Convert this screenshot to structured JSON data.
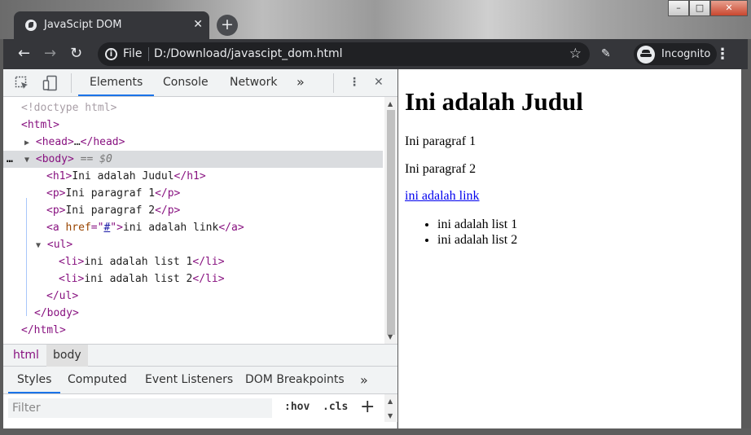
{
  "browser": {
    "tab_title": "JavaScipt DOM",
    "tab_close": "✕",
    "new_tab": "+",
    "window_controls": {
      "minimize": "–",
      "maximize": "□",
      "close": "✕"
    },
    "nav": {
      "back": "←",
      "forward": "→",
      "reload": "↻"
    },
    "omnibox": {
      "scheme": "File",
      "url": "D:/Download/javascipt_dom.html",
      "info_icon": "i"
    },
    "incognito_label": "Incognito",
    "menu": "⋮"
  },
  "devtools": {
    "tabs": [
      "Elements",
      "Console",
      "Network"
    ],
    "more_tabs": "»",
    "menu": "⋮",
    "close": "✕",
    "dom_lines": {
      "doctype": "<!doctype html>",
      "html_open": "html",
      "head": "head",
      "head_ellipsis": "…",
      "body": "body",
      "body_eq": "== $0",
      "selected_dots": "…",
      "h1": "h1",
      "h1_text": "Ini adalah Judul",
      "p": "p",
      "p1_text": "Ini paragraf 1",
      "p2_text": "Ini paragraf 2",
      "a": "a",
      "a_attr": "href",
      "a_val": "#",
      "a_text": "ini adalah link",
      "ul": "ul",
      "li": "li",
      "li1_text": "ini adalah list 1",
      "li2_text": "ini adalah list 2"
    },
    "breadcrumbs": [
      "html",
      "body"
    ],
    "sub_tabs": [
      "Styles",
      "Computed",
      "Event Listeners",
      "DOM Breakpoints"
    ],
    "sub_more": "»",
    "filter_placeholder": "Filter",
    "hov": ":hov",
    "cls": ".cls",
    "add_rule": "+"
  },
  "page": {
    "heading": "Ini adalah Judul",
    "paragraph_1": "Ini paragraf 1",
    "paragraph_2": "Ini paragraf 2",
    "link_text": "ini adalah link",
    "list_items": [
      "ini adalah list 1",
      "ini adalah list 2"
    ]
  },
  "colors": {
    "chrome_dark": "#35363a",
    "omnibox_bg": "#202124",
    "tag": "#881280",
    "attr_name": "#994500",
    "attr_value": "#1a1aa6",
    "accent": "#1a73e8",
    "link": "#0000ee"
  }
}
